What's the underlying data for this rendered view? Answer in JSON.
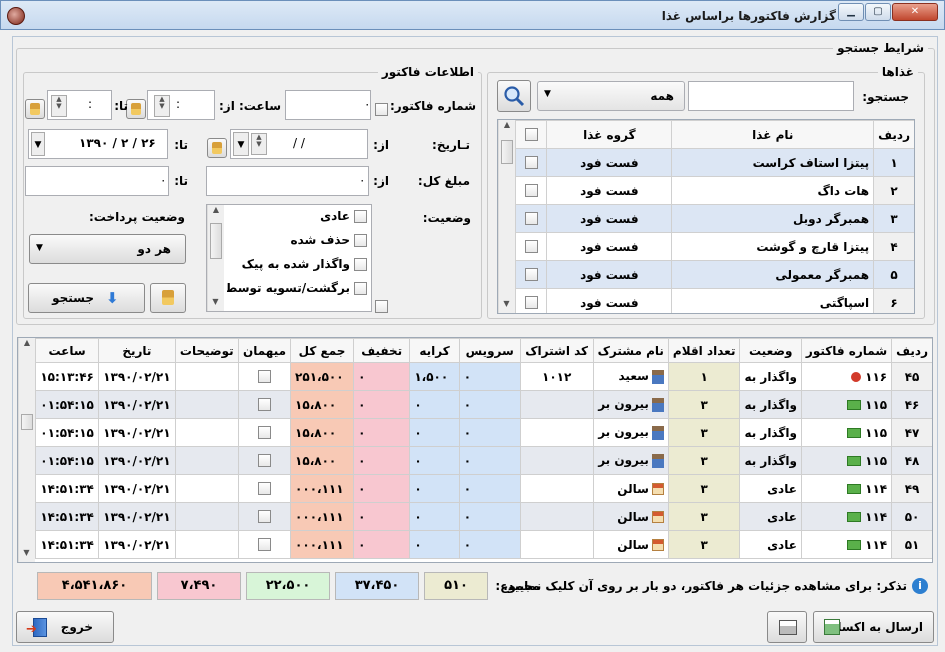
{
  "window": {
    "title": "گزارش فاکتورها براساس غذا"
  },
  "search_conditions": {
    "title": "شرایط جستجو"
  },
  "foods": {
    "group_title": "غذاها",
    "search_label": "جستجو:",
    "combo_value": "همه",
    "col_row": "ردیف",
    "col_name": "نام غذا",
    "col_group": "گروه غذا",
    "rows": [
      {
        "num": "۱",
        "name": "پیتزا استاف کراست",
        "group": "فست فود"
      },
      {
        "num": "۲",
        "name": "هات داگ",
        "group": "فست فود"
      },
      {
        "num": "۳",
        "name": "همبرگر دوبل",
        "group": "فست فود"
      },
      {
        "num": "۴",
        "name": "پیتزا قارچ و گوشت",
        "group": "فست فود"
      },
      {
        "num": "۵",
        "name": "همبرگر معمولی",
        "group": "فست فود"
      },
      {
        "num": "۶",
        "name": "اسپاگتی",
        "group": "فست فود"
      }
    ]
  },
  "invoice_info": {
    "group_title": "اطلاعات فاکتور",
    "invoice_num_label": "شماره فاکتور:",
    "time_label": "ساعت: از:",
    "to_label": "تا:",
    "time_from": ":",
    "time_to": ":",
    "date_label": "تـاریخ:",
    "from_label": "از:",
    "date_from": "/ /",
    "date_to": "۱۳۹۰ / ۲ / ۲۶",
    "amount_label": "مبلغ کل:",
    "amount_from": "٠",
    "amount_to": "٠",
    "status_label": "وضعیت:",
    "status_options": [
      "عادی",
      "حذف شده",
      "واگذار شده به پیک",
      "برگشت/تسویه توسط پیک"
    ],
    "payment_status_label": "وضعیت پرداخت:",
    "payment_value": "هر دو",
    "search_button": "جستجو"
  },
  "grid": {
    "headers": [
      "ردیف",
      "شماره فاکتور",
      "وضعیت",
      "تعداد اقلام",
      "نام مشترک",
      "کد اشتراک",
      "سرویس",
      "کرایه",
      "تخفیف",
      "جمع کل",
      "میهمان",
      "توضیحات",
      "تاریخ",
      "ساعت"
    ],
    "rows": [
      {
        "row": "۴۵",
        "inv": "۱۱۶",
        "status": "واگذار به",
        "count": "۱",
        "cust": "سعید",
        "code": "۱۰۱۲",
        "serv": "٠",
        "kar": "۱،۵٠٠",
        "tak": "٠",
        "jam": "۲۵۱،۵٠٠",
        "desc": "",
        "date": "۱۳۹٠/٠۲/۲۱",
        "time": "۱۵:۱۳:۴۶",
        "ic": "red",
        "ci": "user"
      },
      {
        "row": "۴۶",
        "inv": "۱۱۵",
        "status": "واگذار به",
        "count": "۳",
        "cust": "بیرون بر",
        "code": "",
        "serv": "٠",
        "kar": "٠",
        "tak": "٠",
        "jam": "۱۵،۸٠٠",
        "desc": "",
        "date": "۱۳۹٠/٠۲/۲۱",
        "time": "۱۵:٠۱:۵۴",
        "ic": "money",
        "ci": "user"
      },
      {
        "row": "۴۷",
        "inv": "۱۱۵",
        "status": "واگذار به",
        "count": "۳",
        "cust": "بیرون بر",
        "code": "",
        "serv": "٠",
        "kar": "٠",
        "tak": "٠",
        "jam": "۱۵،۸٠٠",
        "desc": "",
        "date": "۱۳۹٠/٠۲/۲۱",
        "time": "۱۵:٠۱:۵۴",
        "ic": "money",
        "ci": "user"
      },
      {
        "row": "۴۸",
        "inv": "۱۱۵",
        "status": "واگذار به",
        "count": "۳",
        "cust": "بیرون بر",
        "code": "",
        "serv": "٠",
        "kar": "٠",
        "tak": "٠",
        "jam": "۱۵،۸٠٠",
        "desc": "",
        "date": "۱۳۹٠/٠۲/۲۱",
        "time": "۱۵:٠۱:۵۴",
        "ic": "money",
        "ci": "user"
      },
      {
        "row": "۴۹",
        "inv": "۱۱۴",
        "status": "عادی",
        "count": "۳",
        "cust": "سالن",
        "code": "",
        "serv": "٠",
        "kar": "٠",
        "tak": "٠",
        "jam": "۱۱۱،٠٠٠",
        "desc": "",
        "date": "۱۳۹٠/٠۲/۲۱",
        "time": "۱۴:۵۱:۳۴",
        "ic": "money",
        "ci": "home"
      },
      {
        "row": "۵٠",
        "inv": "۱۱۴",
        "status": "عادی",
        "count": "۳",
        "cust": "سالن",
        "code": "",
        "serv": "٠",
        "kar": "٠",
        "tak": "٠",
        "jam": "۱۱۱،٠٠٠",
        "desc": "",
        "date": "۱۳۹٠/٠۲/۲۱",
        "time": "۱۴:۵۱:۳۴",
        "ic": "money",
        "ci": "home"
      },
      {
        "row": "۵۱",
        "inv": "۱۱۴",
        "status": "عادی",
        "count": "۳",
        "cust": "سالن",
        "code": "",
        "serv": "٠",
        "kar": "٠",
        "tak": "٠",
        "jam": "۱۱۱،٠٠٠",
        "desc": "",
        "date": "۱۳۹٠/٠۲/۲۱",
        "time": "۱۴:۵۱:۳۴",
        "ic": "money",
        "ci": "home"
      }
    ]
  },
  "footer": {
    "hint": "تذکر: برای مشاهده جزئیات هر فاکتور، دو بار بر روی آن کلیک نمایید.",
    "sum_label": "مجموع:",
    "sum_count": "۵۱٠",
    "sum_serv": "۳۷،۴۵٠",
    "sum_kar": "۲۲،۵٠٠",
    "sum_tak": "۷،۴۹٠",
    "sum_jam": "۴،۵۴۱،۸۶٠",
    "excel_button": "ارسال به اکسل",
    "exit_button": "خروج"
  }
}
